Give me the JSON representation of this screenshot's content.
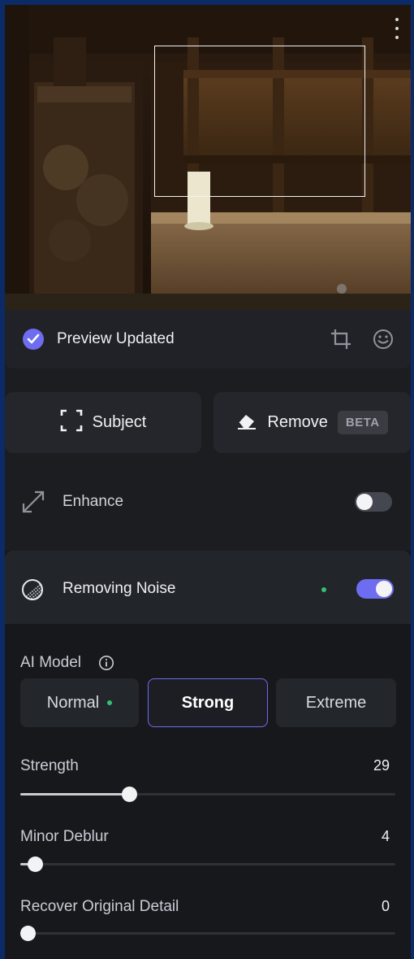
{
  "status": {
    "text": "Preview Updated"
  },
  "actions": {
    "subject_label": "Subject",
    "remove_label": "Remove",
    "beta_badge": "BETA"
  },
  "enhance": {
    "label": "Enhance",
    "enabled": false
  },
  "noise": {
    "label": "Removing Noise",
    "enabled": true,
    "ai_model_label": "AI Model",
    "models": [
      {
        "label": "Normal",
        "has_dot": true,
        "active": false
      },
      {
        "label": "Strong",
        "has_dot": false,
        "active": true
      },
      {
        "label": "Extreme",
        "has_dot": false,
        "active": false
      }
    ],
    "sliders": [
      {
        "label": "Strength",
        "value": "29",
        "max": 100
      },
      {
        "label": "Minor Deblur",
        "value": "4",
        "max": 100
      },
      {
        "label": "Recover Original Detail",
        "value": "0",
        "max": 100
      }
    ]
  },
  "colors": {
    "accent": "#6e6cf0",
    "status_dot": "#34c074",
    "window_border": "#0c2a66"
  },
  "icons": [
    "more-vertical-icon",
    "check-circle-icon",
    "crop-icon",
    "smiley-icon",
    "subject-select-icon",
    "eraser-icon",
    "enhance-arrows-icon",
    "noise-icon",
    "info-icon"
  ]
}
